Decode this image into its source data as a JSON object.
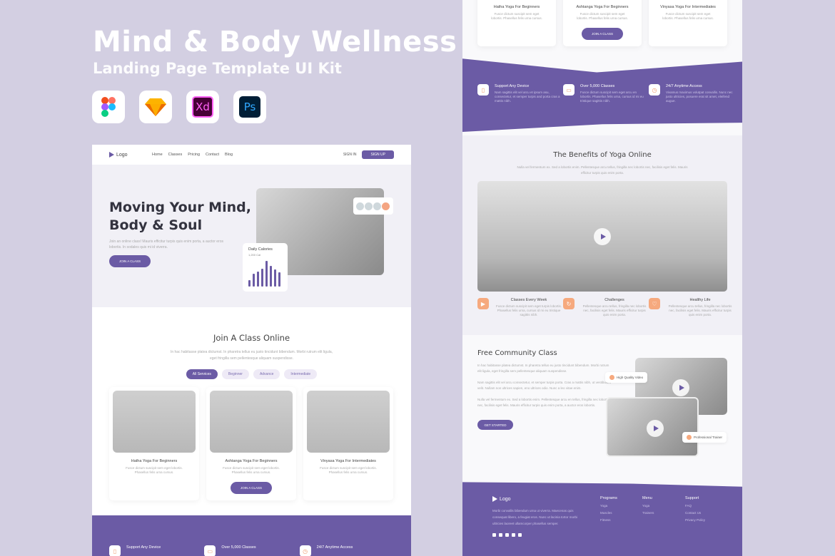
{
  "header": {
    "title": "Mind & Body Wellness",
    "subtitle": "Landing Page Template UI Kit"
  },
  "tools": [
    {
      "name": "figma"
    },
    {
      "name": "sketch"
    },
    {
      "name": "xd",
      "label": "Xd"
    },
    {
      "name": "photoshop",
      "label": "Ps"
    }
  ],
  "nav": {
    "logo": "Logo",
    "links": [
      "Home",
      "Classes",
      "Pricing",
      "Contact",
      "Blog"
    ],
    "signin": "SIGN IN",
    "signup": "SIGN UP"
  },
  "hero": {
    "title_line1": "Moving Your Mind,",
    "title_line2": "Body & Soul",
    "text": "Join an online class! Mauris efficitur turpis quis enim porta, a auctor eros lobortis. In sodales quis mi id viverra.",
    "button": "JOIN A CLASS",
    "calories_title": "Daily Calories",
    "calories_value": "1,200 Cal",
    "calorie_bars": [
      0.25,
      0.5,
      0.58,
      0.7,
      1.0,
      0.8,
      0.68,
      0.55
    ]
  },
  "join": {
    "title": "Join A Class Online",
    "text": "In hac habitasse platea dictumst. In pharetra tellus eu justo tincidunt bibendum. Morbi rutrum elit ligula, eget fringilla sem pellentesque aliquam suspendisse.",
    "filters": [
      "All Services",
      "Beginner",
      "Advance",
      "Intermediate"
    ],
    "cards": [
      {
        "title": "Hatha Yoga For Beginners",
        "desc": "Fusce dictum suscipit sem eget lobortis. Phasellus felis urna cursus."
      },
      {
        "title": "Ashtanga Yoga For Beginners",
        "desc": "Fusce dictum suscipit sem eget lobortis. Phasellus felis urna cursus.",
        "button": "JOIN A CLASS"
      },
      {
        "title": "Vinyasa Yoga For Intermediates",
        "desc": "Fusce dictum suscipit sem eget lobortis. Phasellus felis urna cursus."
      }
    ]
  },
  "features": [
    {
      "title": "Support Any Device",
      "desc": "Nam sagittis elit vel arcu et ipsum asu, consectetur, et semper turpis and porta cras a mattis nibh."
    },
    {
      "title": "Over 5,000 Classes",
      "desc": "Fusce dictum suscipit sem eget arcu en lobortis. Phasellus felis urna, cursus id mi eu tristique sagittis nibh."
    },
    {
      "title": "24/7 Anytime Access",
      "desc": "Vivamus maximus volutpat convallis. Nunc nec justo ultricies, posuere erat sit amet, eleifend augue."
    }
  ],
  "benefits": {
    "title": "The Benefits of Yoga Online",
    "text": "Nulla vel fermentum ex. Sed a lobortis enim. Pellentesque arcu tellus, fringilla nec lobortis nec, facilisis eget felis. Mauris efficitur turpis quis enim porta.",
    "items": [
      {
        "title": "Classes Every Week",
        "desc": "Fusce dictum suscipit sem eget turpis lobortis. Phasellus felis urna, cursus id mi eu tristique sagittis nibh."
      },
      {
        "title": "Challenges",
        "desc": "Pellentesque arcu tellus, fringilla nec lobortis nec, facilisis eget felis. Mauris efficitur turpis quis enim porta."
      },
      {
        "title": "Healthy Life",
        "desc": "Pellentesque arcu tellus, fringilla nec lobortis nec, facilisis eget felis. Mauris efficitur turpis quis enim porta."
      }
    ]
  },
  "community": {
    "title": "Free Community Class",
    "p1": "In hac habitasse platea dictumst. In pharetra tellus eu justo tincidunt bibendum. Morbi rutrum elit ligula, eget fringilla sem pellentesque aliquam suspendisse.",
    "p2": "Nam sagittis elit vel arcu consectetur, et semper turpis porta. Cras a mattis nibh, ut vestibulum velit. Nullam non ultrices sapien, eno ultrices odio. Nunc a leo vitae enim.",
    "p3": "Nulla vel fermentum ex. Sed a lobortis enim. Pellentesque arcu en tellus, fringilla nec lobortis nec, facilisis eget felis. Mauris efficitur turpis quis enim porta, a auctor eros lobortis.",
    "button": "GET STARTED",
    "tag1": "High Quality Video",
    "tag2": "Professional Trainer"
  },
  "footer": {
    "logo": "Logo",
    "text": "Morbi convallis bibendum urna ut viverra. Maecenas quis consequat libero, a feugiat eros. Nunc ut lacinia tortor morbi ultricies laoreet ullamcorper phasellus semper.",
    "columns": [
      {
        "title": "Programs",
        "items": [
          "Yoga",
          "Muscles",
          "Fitness"
        ]
      },
      {
        "title": "Menu",
        "items": [
          "Yoga",
          "Trainers"
        ]
      },
      {
        "title": "Support",
        "items": [
          "FAQ",
          "Contact Us",
          "Privacy Policy"
        ]
      }
    ]
  }
}
